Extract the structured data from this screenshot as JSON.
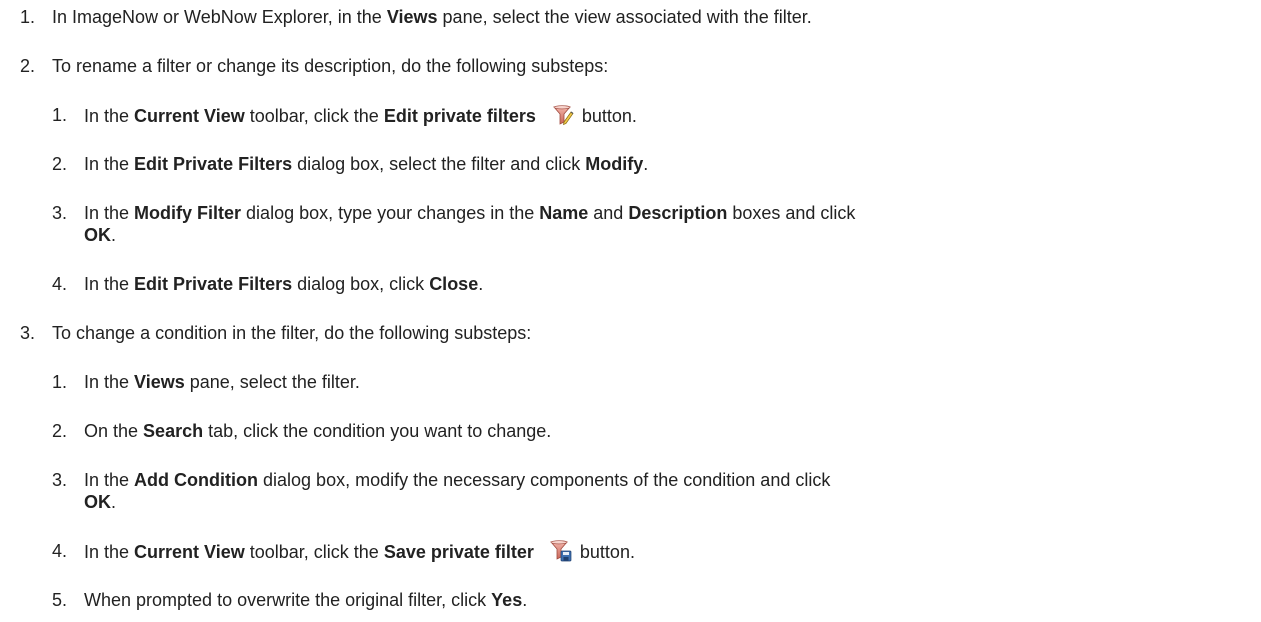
{
  "steps": [
    {
      "num": "1.",
      "parts": [
        {
          "t": "In ImageNow or WebNow Explorer, in the "
        },
        {
          "b": "Views"
        },
        {
          "t": " pane, select the view associated with the filter."
        }
      ]
    },
    {
      "num": "2.",
      "parts": [
        {
          "t": "To rename a filter or change its description, do the following substeps:"
        }
      ],
      "substeps": [
        {
          "num": "1.",
          "parts": [
            {
              "t": "In the "
            },
            {
              "b": "Current View"
            },
            {
              "t": " toolbar, click the "
            },
            {
              "b": "Edit private filters"
            },
            {
              "icon": "edit-filter-icon"
            },
            {
              "t": "button."
            }
          ]
        },
        {
          "num": "2.",
          "parts": [
            {
              "t": "In the "
            },
            {
              "b": "Edit Private Filters"
            },
            {
              "t": " dialog box, select the filter and click "
            },
            {
              "b": "Modify"
            },
            {
              "t": "."
            }
          ]
        },
        {
          "num": "3.",
          "parts": [
            {
              "t": "In the "
            },
            {
              "b": "Modify Filter"
            },
            {
              "t": " dialog box, type your changes in the "
            },
            {
              "b": "Name"
            },
            {
              "t": " and "
            },
            {
              "b": "Description"
            },
            {
              "t": " boxes and click "
            },
            {
              "b": "OK"
            },
            {
              "t": "."
            }
          ]
        },
        {
          "num": "4.",
          "parts": [
            {
              "t": "In the "
            },
            {
              "b": "Edit Private Filters"
            },
            {
              "t": " dialog box, click "
            },
            {
              "b": "Close"
            },
            {
              "t": "."
            }
          ]
        }
      ]
    },
    {
      "num": "3.",
      "parts": [
        {
          "t": "To change a condition in the filter, do the following substeps:"
        }
      ],
      "substeps": [
        {
          "num": "1.",
          "parts": [
            {
              "t": "In the "
            },
            {
              "b": "Views"
            },
            {
              "t": " pane, select the filter."
            }
          ]
        },
        {
          "num": "2.",
          "parts": [
            {
              "t": "On the "
            },
            {
              "b": "Search"
            },
            {
              "t": " tab, click the condition you want to change."
            }
          ]
        },
        {
          "num": "3.",
          "parts": [
            {
              "t": "In the "
            },
            {
              "b": "Add Condition"
            },
            {
              "t": " dialog box, modify the necessary components of the condition and click "
            },
            {
              "b": "OK"
            },
            {
              "t": "."
            }
          ]
        },
        {
          "num": "4.",
          "parts": [
            {
              "t": "In the "
            },
            {
              "b": "Current View"
            },
            {
              "t": " toolbar, click the "
            },
            {
              "b": "Save private filter"
            },
            {
              "icon": "save-filter-icon"
            },
            {
              "t": "button."
            }
          ]
        },
        {
          "num": "5.",
          "parts": [
            {
              "t": "When prompted to overwrite the original filter, click "
            },
            {
              "b": "Yes"
            },
            {
              "t": "."
            }
          ]
        }
      ]
    }
  ]
}
